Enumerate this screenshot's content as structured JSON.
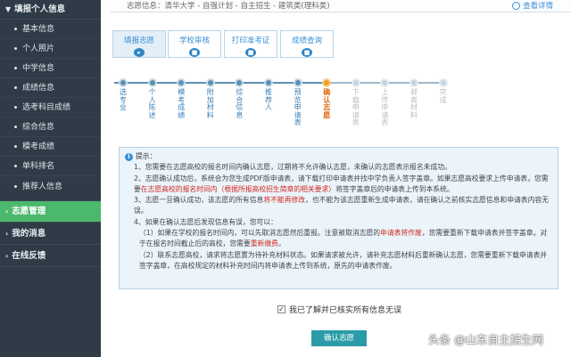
{
  "sidebar": {
    "group_profile": "填报个人信息",
    "items": [
      {
        "label": "基本信息"
      },
      {
        "label": "个人照片"
      },
      {
        "label": "中学信息"
      },
      {
        "label": "成绩信息"
      },
      {
        "label": "选考科目成绩"
      },
      {
        "label": "综合信息"
      },
      {
        "label": "模考成绩"
      },
      {
        "label": "单科排名"
      },
      {
        "label": "推荐人信息"
      }
    ],
    "group_volunteer": "志愿管理",
    "group_messages": "我的消息",
    "group_feedback": "在线反馈"
  },
  "topstrip": {
    "info": "志愿信息：清华大学 - 自强计划 - 自主招生 - 建筑类(理科类)",
    "link": "查看详情"
  },
  "tabs": [
    {
      "label": "填报志愿"
    },
    {
      "label": "学校审核"
    },
    {
      "label": "打印准考证"
    },
    {
      "label": "成绩查询"
    }
  ],
  "steps": [
    {
      "label": "选专业",
      "state": "done"
    },
    {
      "label": "个人陈述",
      "state": "done"
    },
    {
      "label": "模考成绩",
      "state": "done"
    },
    {
      "label": "附加材料",
      "state": "done"
    },
    {
      "label": "综合信息",
      "state": "done"
    },
    {
      "label": "推荐人",
      "state": "done"
    },
    {
      "label": "预览申请表",
      "state": "done"
    },
    {
      "label": "确认志愿",
      "state": "current"
    },
    {
      "label": "下载申请表",
      "state": "todo"
    },
    {
      "label": "上传申请表",
      "state": "todo"
    },
    {
      "label": "邮寄材料",
      "state": "todo"
    },
    {
      "label": "完成",
      "state": "todo"
    }
  ],
  "notice": {
    "title": "提示：",
    "l1": "1、您需要在志愿高校的报名时间内确认志愿，过期将不允许确认志愿，未确认的志愿表示报名未成功。",
    "l2a": "2、志愿确认成功后，系统会为您生成PDF版申请表，请下载打印申请表并找中学负责人签字盖章。如果志愿高校要求上传申请表，您需要",
    "l2red": "在志愿高校的报名时间内（根据所报高校招生简章的相关要求）",
    "l2b": "将签字盖章后的申请表上传到本系统。",
    "l3a": "3、志愿一旦确认成功，该志愿的所有信息",
    "l3red": "将不能再修改",
    "l3b": "，也不能为该志愿重新生成申请表，请在确认之前核实志愿信息和申请表内容无误。",
    "l4": "4、如果在确认志愿后发现信息有误，您可以：",
    "l5a": "（1）如果在学校的报名时间内，可以先取消志愿然后重报。注意被取消志愿的",
    "l5red": "申请表将作废",
    "l5b": "，您需要重新下载申请表并签字盖章。对于在报名时间截止后的高校，您需要",
    "l5red2": "重新缴费",
    "l5c": "。",
    "l6": "（2）联系志愿高校，请求将志愿置为待补充材料状态。如果请求被允许，请补充志愿材料后重新确认志愿，您需要重新下载申请表并签字盖章，在高校规定的材料补充时间内将申请表上传到系统，原先的申请表作废。"
  },
  "confirm_check": "我已了解并已核实所有信息无误",
  "confirm_button": "确认志愿",
  "watermark": "头条 @山东自主招生网"
}
